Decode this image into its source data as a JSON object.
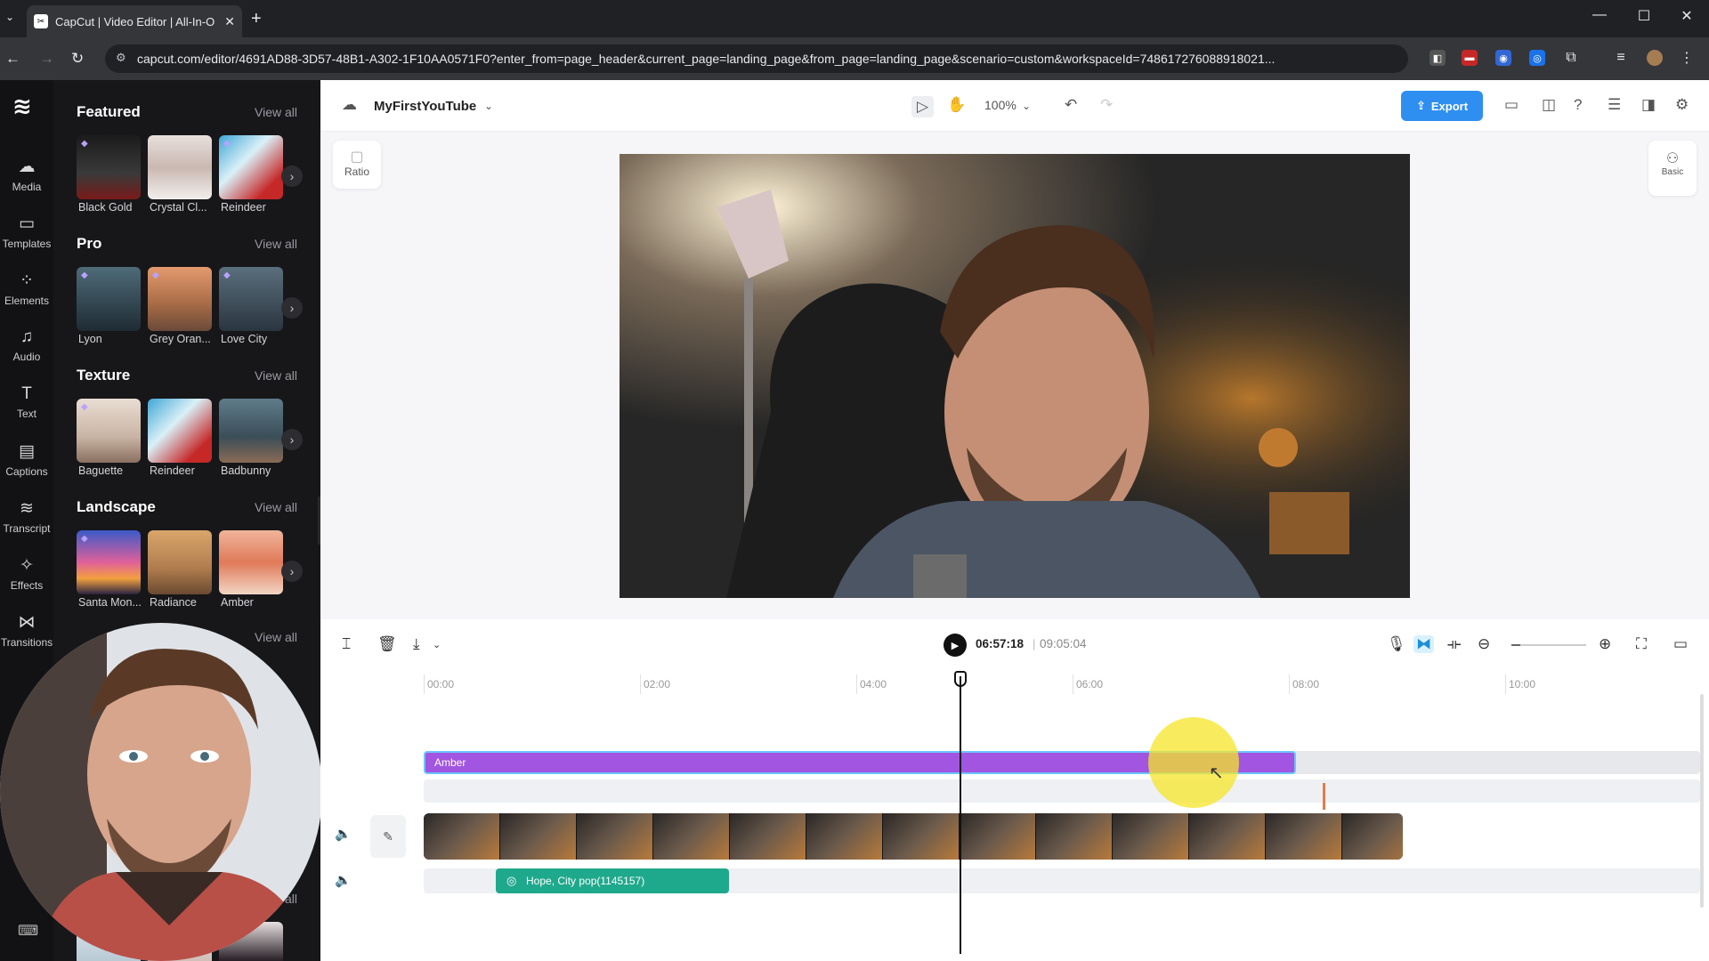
{
  "browser": {
    "tab_title": "CapCut | Video Editor | All-In-O",
    "url": "capcut.com/editor/4691AD88-3D57-48B1-A302-1F10AA0571F0?enter_from=page_header&current_page=landing_page&from_page=landing_page&scenario=custom&workspaceId=748617276088918021...",
    "new_tab": "+",
    "close": "✕"
  },
  "rail": {
    "items": [
      {
        "label": "Media",
        "icon": "cloud-upload-icon"
      },
      {
        "label": "Templates",
        "icon": "templates-icon"
      },
      {
        "label": "Elements",
        "icon": "elements-icon"
      },
      {
        "label": "Audio",
        "icon": "music-note-icon"
      },
      {
        "label": "Text",
        "icon": "text-icon"
      },
      {
        "label": "Captions",
        "icon": "captions-icon"
      },
      {
        "label": "Transcript",
        "icon": "transcript-icon"
      },
      {
        "label": "Effects",
        "icon": "sparkle-icon"
      },
      {
        "label": "Transitions",
        "icon": "transitions-icon"
      }
    ]
  },
  "panel": {
    "view_all": "View all",
    "sections": [
      {
        "title": "Featured",
        "items": [
          "Black Gold",
          "Crystal Cl...",
          "Reindeer"
        ]
      },
      {
        "title": "Pro",
        "items": [
          "Lyon",
          "Grey Oran...",
          "Love City"
        ]
      },
      {
        "title": "Texture",
        "items": [
          "Baguette",
          "Reindeer",
          "Badbunny"
        ]
      },
      {
        "title": "Landscape",
        "items": [
          "Santa Mon...",
          "Radiance",
          "Amber"
        ]
      }
    ],
    "extra_view_all_1": "View all",
    "extra_view_all_2": "ew all"
  },
  "toolbar": {
    "project_name": "MyFirstYouTube",
    "zoom": "100%",
    "export_label": "Export"
  },
  "canvas": {
    "ratio_label": "Ratio",
    "basic_label": "Basic"
  },
  "timeline": {
    "current_time": "06:57:18",
    "separator": "|",
    "duration": "09:05:04",
    "ticks": [
      "00:00",
      "02:00",
      "04:00",
      "06:00",
      "08:00",
      "10:00"
    ],
    "effect_clip_label": "Amber",
    "audio_clip_label": "Hope, City pop(1145157)"
  },
  "colors": {
    "accent": "#2f8ff0",
    "effect_clip": "#a155e0",
    "audio_clip": "#1fa98c"
  }
}
